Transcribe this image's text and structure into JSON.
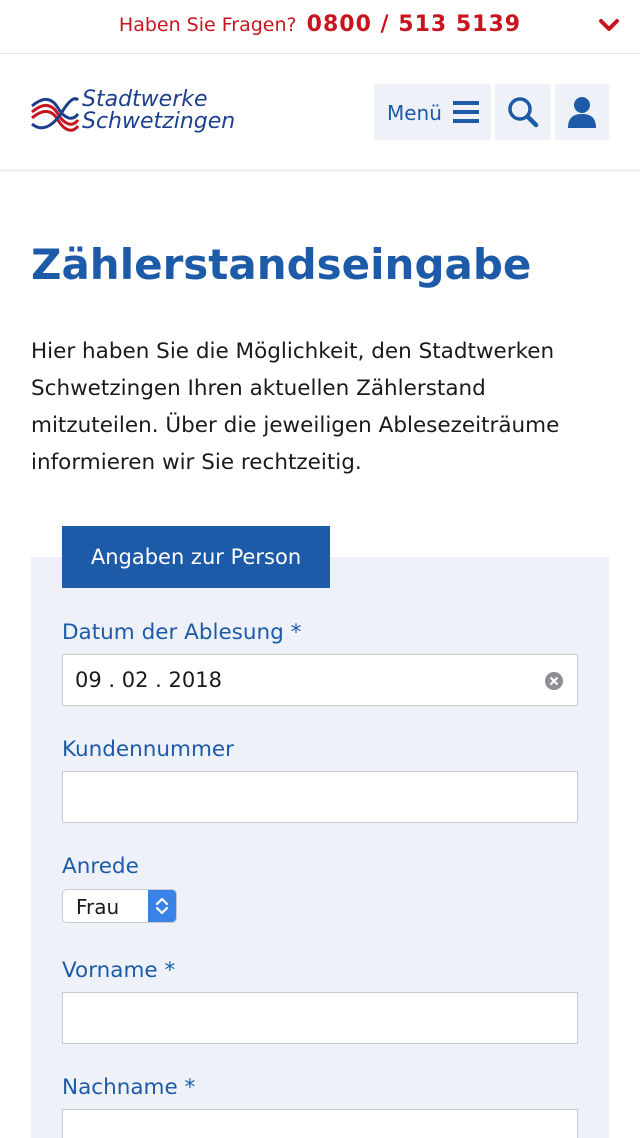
{
  "topbar": {
    "question": "Haben Sie Fragen?",
    "phone": "0800 / 513 5139",
    "expand_icon": "chevron-down-icon",
    "color": "#c8141e"
  },
  "header": {
    "logo_line1": "Stadtwerke",
    "logo_line2": "Schwetzingen",
    "menu_label": "Menü",
    "menu_icon": "hamburger-icon",
    "search_icon": "search-icon",
    "user_icon": "user-icon"
  },
  "page": {
    "title": "Zählerstandseingabe",
    "intro": "Hier haben Sie die Möglichkeit, den Stadtwerken Schwetzingen Ihren aktuellen Zählerstand mitzuteilen. Über die jeweiligen Ablesezeiträume informieren wir Sie rechtzeitig."
  },
  "form": {
    "tab_label": "Angaben zur Person",
    "date_label": "Datum der Ablesung *",
    "date_value": "09 . 02 . 2018",
    "customer_label": "Kundennummer",
    "customer_value": "",
    "salutation_label": "Anrede",
    "salutation_value": "Frau",
    "firstname_label": "Vorname *",
    "firstname_value": "",
    "lastname_label": "Nachname *",
    "lastname_value": ""
  },
  "colors": {
    "brand_blue": "#1d5aa8",
    "brand_red": "#c8141e",
    "panel_bg": "#eef2f8"
  }
}
